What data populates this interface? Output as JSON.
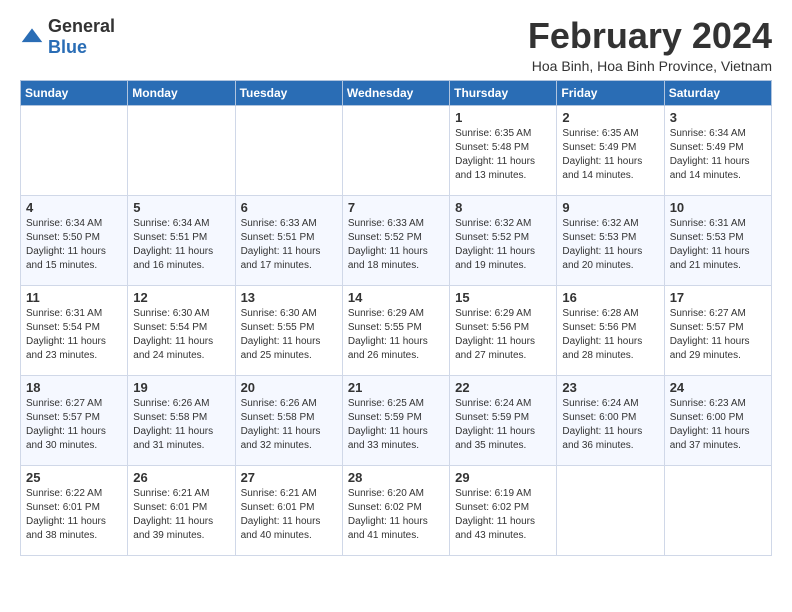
{
  "logo": {
    "general": "General",
    "blue": "Blue"
  },
  "title": {
    "month": "February 2024",
    "location": "Hoa Binh, Hoa Binh Province, Vietnam"
  },
  "headers": [
    "Sunday",
    "Monday",
    "Tuesday",
    "Wednesday",
    "Thursday",
    "Friday",
    "Saturday"
  ],
  "weeks": [
    [
      {
        "day": "",
        "lines": []
      },
      {
        "day": "",
        "lines": []
      },
      {
        "day": "",
        "lines": []
      },
      {
        "day": "",
        "lines": []
      },
      {
        "day": "1",
        "lines": [
          "Sunrise: 6:35 AM",
          "Sunset: 5:48 PM",
          "Daylight: 11 hours",
          "and 13 minutes."
        ]
      },
      {
        "day": "2",
        "lines": [
          "Sunrise: 6:35 AM",
          "Sunset: 5:49 PM",
          "Daylight: 11 hours",
          "and 14 minutes."
        ]
      },
      {
        "day": "3",
        "lines": [
          "Sunrise: 6:34 AM",
          "Sunset: 5:49 PM",
          "Daylight: 11 hours",
          "and 14 minutes."
        ]
      }
    ],
    [
      {
        "day": "4",
        "lines": [
          "Sunrise: 6:34 AM",
          "Sunset: 5:50 PM",
          "Daylight: 11 hours",
          "and 15 minutes."
        ]
      },
      {
        "day": "5",
        "lines": [
          "Sunrise: 6:34 AM",
          "Sunset: 5:51 PM",
          "Daylight: 11 hours",
          "and 16 minutes."
        ]
      },
      {
        "day": "6",
        "lines": [
          "Sunrise: 6:33 AM",
          "Sunset: 5:51 PM",
          "Daylight: 11 hours",
          "and 17 minutes."
        ]
      },
      {
        "day": "7",
        "lines": [
          "Sunrise: 6:33 AM",
          "Sunset: 5:52 PM",
          "Daylight: 11 hours",
          "and 18 minutes."
        ]
      },
      {
        "day": "8",
        "lines": [
          "Sunrise: 6:32 AM",
          "Sunset: 5:52 PM",
          "Daylight: 11 hours",
          "and 19 minutes."
        ]
      },
      {
        "day": "9",
        "lines": [
          "Sunrise: 6:32 AM",
          "Sunset: 5:53 PM",
          "Daylight: 11 hours",
          "and 20 minutes."
        ]
      },
      {
        "day": "10",
        "lines": [
          "Sunrise: 6:31 AM",
          "Sunset: 5:53 PM",
          "Daylight: 11 hours",
          "and 21 minutes."
        ]
      }
    ],
    [
      {
        "day": "11",
        "lines": [
          "Sunrise: 6:31 AM",
          "Sunset: 5:54 PM",
          "Daylight: 11 hours",
          "and 23 minutes."
        ]
      },
      {
        "day": "12",
        "lines": [
          "Sunrise: 6:30 AM",
          "Sunset: 5:54 PM",
          "Daylight: 11 hours",
          "and 24 minutes."
        ]
      },
      {
        "day": "13",
        "lines": [
          "Sunrise: 6:30 AM",
          "Sunset: 5:55 PM",
          "Daylight: 11 hours",
          "and 25 minutes."
        ]
      },
      {
        "day": "14",
        "lines": [
          "Sunrise: 6:29 AM",
          "Sunset: 5:55 PM",
          "Daylight: 11 hours",
          "and 26 minutes."
        ]
      },
      {
        "day": "15",
        "lines": [
          "Sunrise: 6:29 AM",
          "Sunset: 5:56 PM",
          "Daylight: 11 hours",
          "and 27 minutes."
        ]
      },
      {
        "day": "16",
        "lines": [
          "Sunrise: 6:28 AM",
          "Sunset: 5:56 PM",
          "Daylight: 11 hours",
          "and 28 minutes."
        ]
      },
      {
        "day": "17",
        "lines": [
          "Sunrise: 6:27 AM",
          "Sunset: 5:57 PM",
          "Daylight: 11 hours",
          "and 29 minutes."
        ]
      }
    ],
    [
      {
        "day": "18",
        "lines": [
          "Sunrise: 6:27 AM",
          "Sunset: 5:57 PM",
          "Daylight: 11 hours",
          "and 30 minutes."
        ]
      },
      {
        "day": "19",
        "lines": [
          "Sunrise: 6:26 AM",
          "Sunset: 5:58 PM",
          "Daylight: 11 hours",
          "and 31 minutes."
        ]
      },
      {
        "day": "20",
        "lines": [
          "Sunrise: 6:26 AM",
          "Sunset: 5:58 PM",
          "Daylight: 11 hours",
          "and 32 minutes."
        ]
      },
      {
        "day": "21",
        "lines": [
          "Sunrise: 6:25 AM",
          "Sunset: 5:59 PM",
          "Daylight: 11 hours",
          "and 33 minutes."
        ]
      },
      {
        "day": "22",
        "lines": [
          "Sunrise: 6:24 AM",
          "Sunset: 5:59 PM",
          "Daylight: 11 hours",
          "and 35 minutes."
        ]
      },
      {
        "day": "23",
        "lines": [
          "Sunrise: 6:24 AM",
          "Sunset: 6:00 PM",
          "Daylight: 11 hours",
          "and 36 minutes."
        ]
      },
      {
        "day": "24",
        "lines": [
          "Sunrise: 6:23 AM",
          "Sunset: 6:00 PM",
          "Daylight: 11 hours",
          "and 37 minutes."
        ]
      }
    ],
    [
      {
        "day": "25",
        "lines": [
          "Sunrise: 6:22 AM",
          "Sunset: 6:01 PM",
          "Daylight: 11 hours",
          "and 38 minutes."
        ]
      },
      {
        "day": "26",
        "lines": [
          "Sunrise: 6:21 AM",
          "Sunset: 6:01 PM",
          "Daylight: 11 hours",
          "and 39 minutes."
        ]
      },
      {
        "day": "27",
        "lines": [
          "Sunrise: 6:21 AM",
          "Sunset: 6:01 PM",
          "Daylight: 11 hours",
          "and 40 minutes."
        ]
      },
      {
        "day": "28",
        "lines": [
          "Sunrise: 6:20 AM",
          "Sunset: 6:02 PM",
          "Daylight: 11 hours",
          "and 41 minutes."
        ]
      },
      {
        "day": "29",
        "lines": [
          "Sunrise: 6:19 AM",
          "Sunset: 6:02 PM",
          "Daylight: 11 hours",
          "and 43 minutes."
        ]
      },
      {
        "day": "",
        "lines": []
      },
      {
        "day": "",
        "lines": []
      }
    ]
  ]
}
